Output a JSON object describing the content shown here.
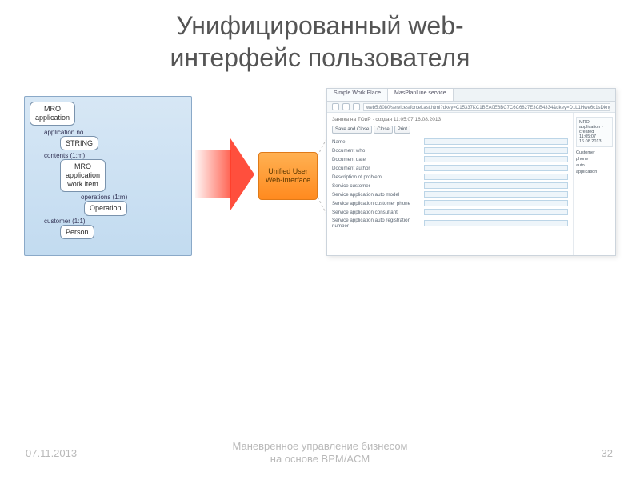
{
  "title_line1": "Унифицированный web-",
  "title_line2": "интерфейс пользователя",
  "tree": {
    "root": "MRO\napplication",
    "app_no_label": "application no",
    "string_node": "STRING",
    "contents_label": "contents (1:m)",
    "work_item_node": "MRO\napplication\nwork item",
    "operations_label": "operations (1:m)",
    "operation_node": "Operation",
    "customer_label": "customer (1:1)",
    "person_node": "Person"
  },
  "center_box": "Unified User\nWeb-Interface",
  "browser": {
    "tab1": "Simple Work Place",
    "tab2": "MasPlanLine service",
    "url": "web5:8080/services/forceLast.html?dkey=C15337KC1BEA0E6BC7C6C6827E3CB4334&dkey=D1L1Hwe6c1sDkngVoren1Fdcs1gNocate=en",
    "header": "Заявка на ТОиР · создан 11:05:07 16.08.2013",
    "buttons": {
      "save_close": "Save and Close",
      "close": "Close",
      "print": "Print"
    },
    "labels": [
      "Name",
      "Document who",
      "Document date",
      "Document author",
      "Description of problem",
      "Service customer",
      "Service application auto model",
      "Service application customer phone",
      "Service application consultant",
      "Service application auto registration number"
    ],
    "side_header": "MRO application - created 11:05:07 16.08.2013",
    "side_items": [
      "Customer",
      "phone",
      "auto",
      "application"
    ]
  },
  "footer": {
    "date": "07.11.2013",
    "caption_line1": "Маневренное управление бизнесом",
    "caption_line2": "на основе BPM/ACM",
    "page": "32"
  }
}
